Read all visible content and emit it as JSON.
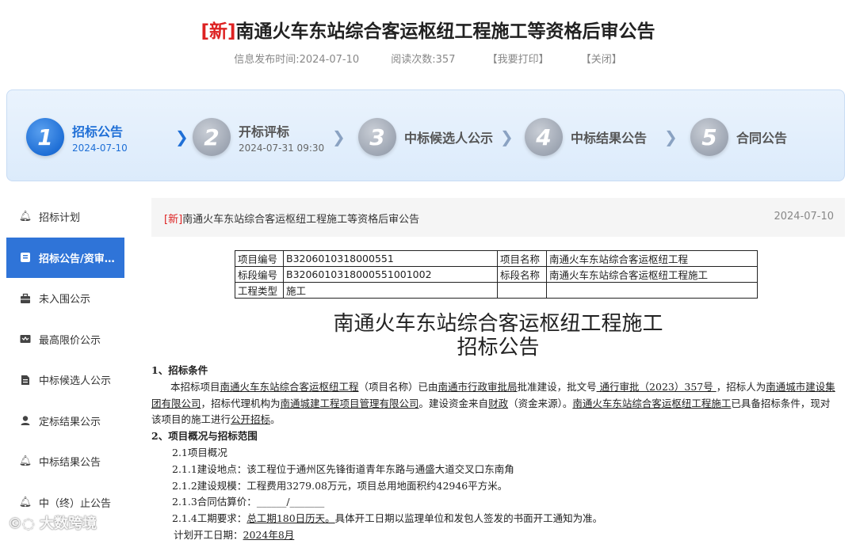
{
  "header": {
    "new_tag": "[新]",
    "title": "南通火车东站综合客运枢纽工程施工等资格后审公告",
    "publish_time": "信息发布时间:2024-07-10",
    "read_count": "阅读次数:357",
    "print_link": "【我要打印】",
    "close_link": "【关闭】"
  },
  "steps": [
    {
      "num": "1",
      "label": "招标公告",
      "date": "2024-07-10"
    },
    {
      "num": "2",
      "label": "开标评标",
      "date": "2024-07-31 09:30"
    },
    {
      "num": "3",
      "label": "中标候选人公示",
      "date": ""
    },
    {
      "num": "4",
      "label": "中标结果公告",
      "date": ""
    },
    {
      "num": "5",
      "label": "合同公告",
      "date": ""
    }
  ],
  "sidebar": {
    "items": [
      {
        "label": "招标计划",
        "icon": "bell-icon"
      },
      {
        "label": "招标公告/资审…",
        "icon": "notice-icon"
      },
      {
        "label": "未入围公示",
        "icon": "briefcase-icon"
      },
      {
        "label": "最高限价公示",
        "icon": "price-icon"
      },
      {
        "label": "中标候选人公示",
        "icon": "document-icon"
      },
      {
        "label": "定标结果公示",
        "icon": "person-icon"
      },
      {
        "label": "中标结果公告",
        "icon": "bell-icon"
      },
      {
        "label": "中（终）止公告",
        "icon": "bell-icon"
      }
    ]
  },
  "watermark": "大数跨境",
  "article_head": {
    "new_tag": "[新]",
    "title": "南通火车东站综合客运枢纽工程施工等资格后审公告",
    "date": "2024-07-10"
  },
  "info_table": {
    "project_code_label": "项目编号",
    "project_code": "B3206010318000551",
    "project_name_label": "项目名称",
    "project_name": "南通火车东站综合客运枢纽工程",
    "section_code_label": "标段编号",
    "section_code": "B3206010318000551001002",
    "section_name_label": "标段名称",
    "section_name": "南通火车东站综合客运枢纽工程施工",
    "type_label": "工程类型",
    "type": "施工"
  },
  "doc": {
    "title_line1": "南通火车东站综合客运枢纽工程施工",
    "title_line2": "招标公告",
    "s1_heading": "1、招标条件",
    "s1_a": "本招标项目",
    "s1_project": "南通火车东站综合客运枢纽工程",
    "s1_b": "（项目名称）已由",
    "s1_authority": "南通市行政审批局",
    "s1_c": "批准建设，批文号",
    "s1_approval": "  通行审批（2023）357号 ",
    "s1_d": "，招标人为",
    "s1_tenderer": "南通城市建设集团有限公司",
    "s1_e": "，招标代理机构为",
    "s1_agency": "南通城建工程项目管理有限公司",
    "s1_f": "。建设资金来自",
    "s1_fund": "财政",
    "s1_g": "（资金来源）。",
    "s1_project2": "南通火车东站综合客运枢纽工程施工",
    "s1_h": "已具备招标条件，现对该项目的施工进行",
    "s1_method": "公开招标",
    "s1_i": "。",
    "s2_heading": "2、项目概况与招标范围",
    "s2_1": "2.1项目概况",
    "s2_1_1": "2.1.1建设地点：该工程位于通州区先锋街道青年东路与通盛大道交叉口东南角",
    "s2_1_2": "2.1.2建设规模：工程费用3279.08万元，项目总用地面积约42946平方米。",
    "s2_1_3_label": "2.1.3合同估算价：",
    "s2_1_3_value": "______/_______",
    "s2_1_4_label": "2.1.4工期要求：",
    "s2_1_4_value": "总工期180日历天。",
    "s2_1_4_rest": "具体开工日期以监理单位和发包人签发的书面开工通知为准。",
    "plan_start_label": "计划开工日期：",
    "plan_start_value": "2024年8月"
  }
}
